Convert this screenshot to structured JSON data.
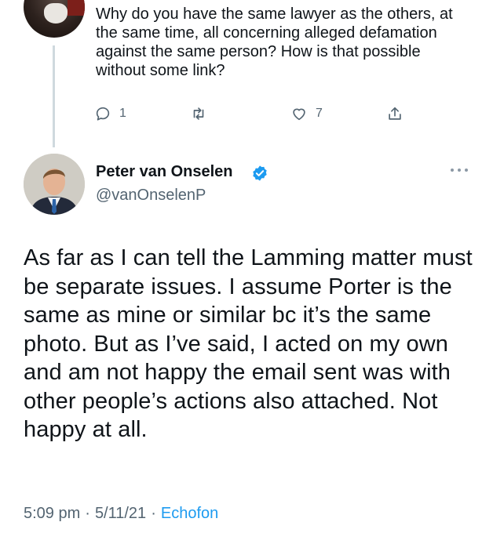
{
  "parent_tweet": {
    "text": "Why do you have the same lawyer as the others, at the same time, all concerning alleged defamation against the same person? How is that possible without some link?",
    "reply_count": "1",
    "like_count": "7"
  },
  "tweet": {
    "author_name": "Peter van Onselen",
    "author_handle": "@vanOnselenP",
    "text": "As far as I can tell the Lamming matter must be separate issues. I assume Porter is the same as mine or similar bc it’s the same photo. But as I’ve said, I acted on my own and am not happy the email sent was with other people’s actions also attached. Not happy at all.",
    "time": "5:09 pm",
    "date": "5/11/21",
    "separator": "·",
    "source": "Echofon"
  },
  "colors": {
    "text": "#0f1419",
    "secondary": "#536471",
    "accent": "#1d9bf0",
    "thread_line": "#cfd9de"
  },
  "icons": {
    "reply": "reply-icon",
    "retweet": "retweet-icon",
    "like": "heart-icon",
    "share": "share-icon",
    "verified": "verified-badge-icon",
    "more": "more-icon"
  }
}
